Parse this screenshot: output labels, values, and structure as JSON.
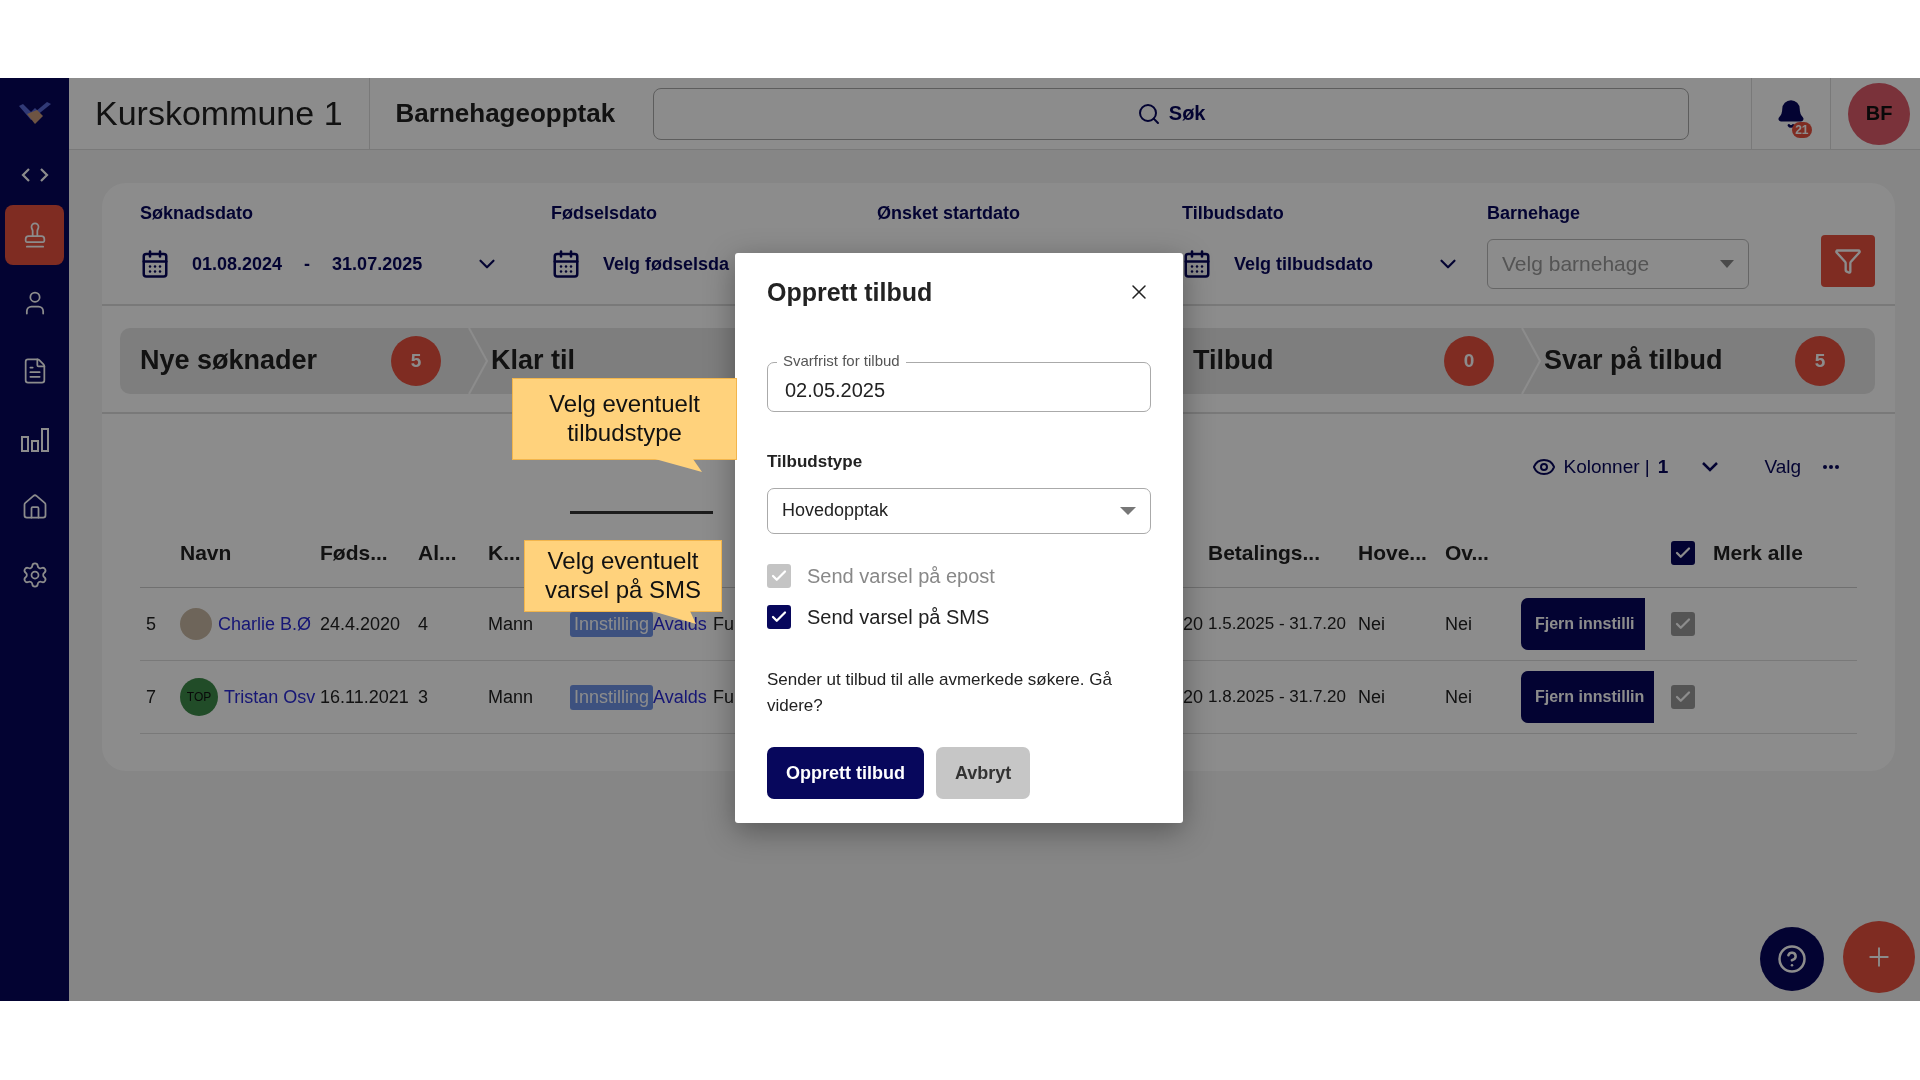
{
  "header": {
    "org_name": "Kurskommune 1",
    "module": "Barnehageopptak",
    "search_placeholder": "Søk",
    "notification_count": "21",
    "user_initials": "BF"
  },
  "sidebar": {
    "items": [
      {
        "selected": true
      },
      {
        "selected": false
      },
      {
        "selected": false
      },
      {
        "selected": false
      },
      {
        "selected": false
      },
      {
        "selected": false
      }
    ]
  },
  "filters": [
    {
      "kind": "range",
      "label": "Søknadsdato",
      "from": "01.08.2024",
      "separator": "-",
      "to": "31.07.2025"
    },
    {
      "kind": "date",
      "label": "Fødselsdato",
      "value": "Velg fødselsda"
    },
    {
      "kind": "date",
      "label": "Ønsket startdato"
    },
    {
      "kind": "date",
      "label": "Tilbudsdato",
      "value": "Velg tilbudsdato"
    },
    {
      "kind": "select",
      "label": "Barnehage",
      "placeholder": "Velg barnehage"
    }
  ],
  "pipeline": [
    {
      "label": "Nye søknader",
      "count": "5"
    },
    {
      "label": "Klar til"
    },
    {
      "label": "Tilbud",
      "count": "0"
    },
    {
      "label": "Svar på tilbud",
      "count": "5"
    }
  ],
  "table": {
    "toolbar": {
      "columns_label": "Kolonner |",
      "columns_count": "1",
      "options_label": "Valg"
    },
    "headers": {
      "name": "Navn",
      "birth_date": "Føds...",
      "age": "Al...",
      "gender": "K...",
      "payment": "Betalings...",
      "main": "Hove...",
      "over": "Ov...",
      "select_all": "Merk alle",
      "select_all_checked": true
    },
    "rows": [
      {
        "index": "5",
        "avatar": {
          "kind": "photo"
        },
        "name": "Charlie B.Ø",
        "birth_date": "24.4.2020",
        "age": "4",
        "gender": "Mann",
        "status": "Innstilling",
        "kindergarten": "Avalds",
        "column_7": "Fu",
        "column_8": "20",
        "payment": "1.5.2025 - 31.7.20",
        "main": "Nei",
        "over": "Nei",
        "action": "Fjern innstilli",
        "checked": true
      },
      {
        "index": "7",
        "avatar": {
          "kind": "initials",
          "text": "TOP"
        },
        "name": "Tristan Osv",
        "birth_date": "16.11.2021",
        "age": "3",
        "gender": "Mann",
        "status": "Innstilling",
        "kindergarten": "Avalds",
        "column_7": "Fu",
        "column_8": "20",
        "payment": "1.8.2025 - 31.7.20",
        "main": "Nei",
        "over": "Nei",
        "action": "Fjern innstillin",
        "checked": true
      }
    ]
  },
  "dialog": {
    "title": "Opprett tilbud",
    "deadline_label": "Svarfrist for tilbud",
    "deadline_value": "02.05.2025",
    "type_label": "Tilbudstype",
    "type_value": "Hovedopptak",
    "options": [
      {
        "label": "Send varsel på epost",
        "checked": true,
        "disabled": true
      },
      {
        "label": "Send varsel på SMS",
        "checked": true,
        "disabled": false
      }
    ],
    "message": "Sender ut tilbud til alle avmerkede søkere. Gå videre?",
    "confirm": "Opprett tilbud",
    "cancel": "Avbryt"
  },
  "callouts": [
    {
      "text": "Velg eventuelt tilbudstype"
    },
    {
      "text": "Velg eventuelt varsel på SMS"
    }
  ]
}
